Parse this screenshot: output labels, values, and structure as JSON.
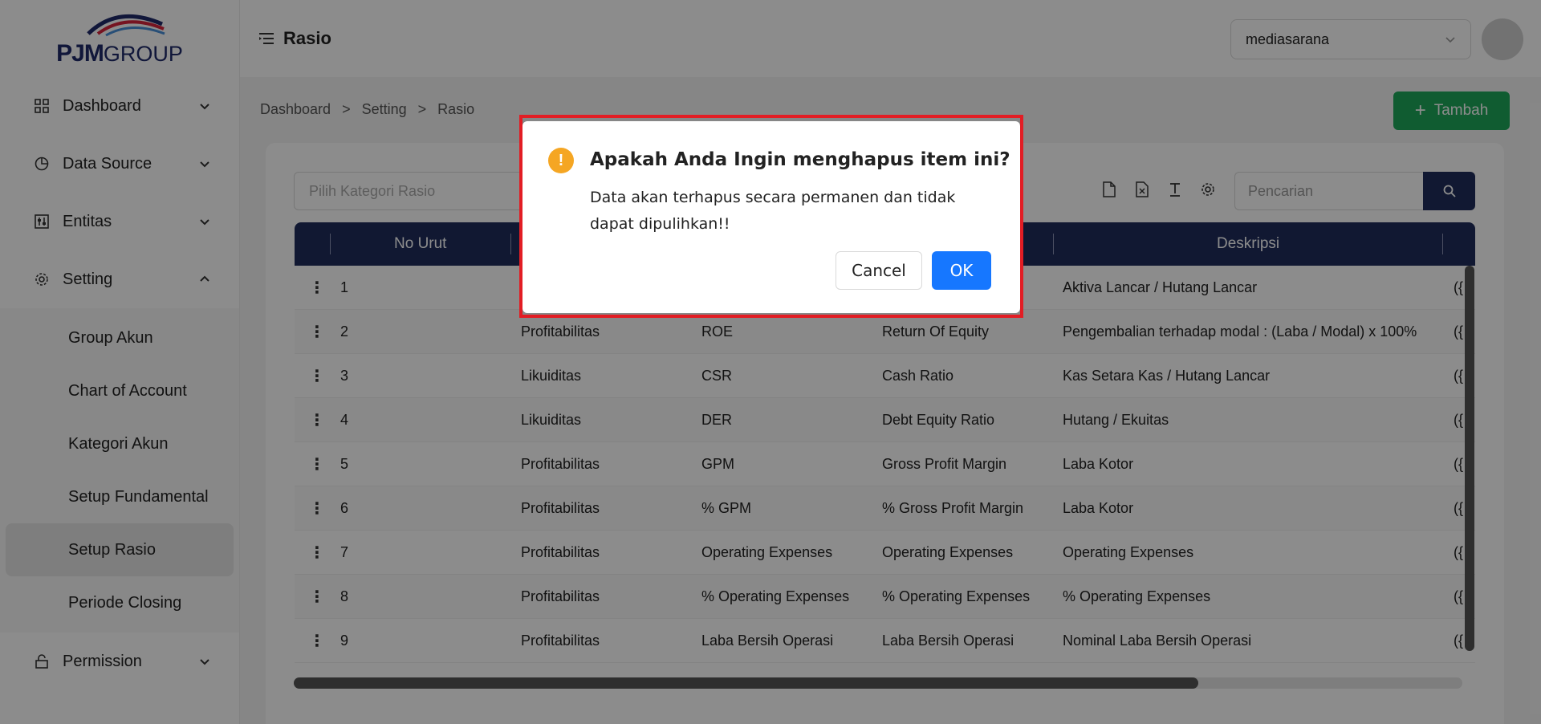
{
  "brand": {
    "logo_main": "PJM",
    "logo_sub": "GROUP"
  },
  "header": {
    "title": "Rasio",
    "company_select": "mediasarana"
  },
  "sidebar": {
    "items": [
      {
        "label": "Dashboard",
        "icon": "dashboard-icon",
        "expanded": false
      },
      {
        "label": "Data Source",
        "icon": "pie-chart-icon",
        "expanded": false
      },
      {
        "label": "Entitas",
        "icon": "sliders-icon",
        "expanded": false
      },
      {
        "label": "Setting",
        "icon": "gear-icon",
        "expanded": true
      },
      {
        "label": "Permission",
        "icon": "lock-icon",
        "expanded": false
      }
    ],
    "setting_sub": [
      {
        "label": "Group Akun"
      },
      {
        "label": "Chart of Account"
      },
      {
        "label": "Kategori Akun"
      },
      {
        "label": "Setup Fundamental"
      },
      {
        "label": "Setup Rasio",
        "active": true
      },
      {
        "label": "Periode Closing"
      }
    ]
  },
  "breadcrumb": [
    "Dashboard",
    ">",
    "Setting",
    ">",
    "Rasio"
  ],
  "actions": {
    "add_label": "Tambah"
  },
  "filter": {
    "placeholder": "Pilih Kategori Rasio"
  },
  "search": {
    "placeholder": "Pencarian"
  },
  "table": {
    "headers": {
      "no_urut": "No Urut",
      "deskripsi": "Deskripsi"
    },
    "rows": [
      {
        "no": "1",
        "kategori": "",
        "kode": "",
        "nama": "",
        "deskripsi": "Aktiva Lancar / Hutang Lancar",
        "extra": "({"
      },
      {
        "no": "2",
        "kategori": "Profitabilitas",
        "kode": "ROE",
        "nama": "Return Of Equity",
        "deskripsi": "Pengembalian terhadap modal : (Laba / Modal) x 100%",
        "extra": "({"
      },
      {
        "no": "3",
        "kategori": "Likuiditas",
        "kode": "CSR",
        "nama": "Cash Ratio",
        "deskripsi": "Kas Setara Kas / Hutang Lancar",
        "extra": "({"
      },
      {
        "no": "4",
        "kategori": "Likuiditas",
        "kode": "DER",
        "nama": "Debt Equity Ratio",
        "deskripsi": "Hutang / Ekuitas",
        "extra": "({"
      },
      {
        "no": "5",
        "kategori": "Profitabilitas",
        "kode": "GPM",
        "nama": "Gross Profit Margin",
        "deskripsi": "Laba Kotor",
        "extra": "({"
      },
      {
        "no": "6",
        "kategori": "Profitabilitas",
        "kode": "% GPM",
        "nama": "% Gross Profit Margin",
        "deskripsi": "Laba Kotor",
        "extra": "({"
      },
      {
        "no": "7",
        "kategori": "Profitabilitas",
        "kode": "Operating Expenses",
        "nama": "Operating Expenses",
        "deskripsi": "Operating Expenses",
        "extra": "({"
      },
      {
        "no": "8",
        "kategori": "Profitabilitas",
        "kode": "% Operating Expenses",
        "nama": "% Operating Expenses",
        "deskripsi": "% Operating Expenses",
        "extra": "({"
      },
      {
        "no": "9",
        "kategori": "Profitabilitas",
        "kode": "Laba Bersih Operasi",
        "nama": "Laba Bersih Operasi",
        "deskripsi": "Nominal Laba Bersih Operasi",
        "extra": "({"
      }
    ]
  },
  "dialog": {
    "title": "Apakah Anda Ingin menghapus item ini?",
    "message": "Data akan terhapus secara permanen dan tidak dapat dipulihkan!!",
    "cancel_label": "Cancel",
    "ok_label": "OK",
    "icon": "warning-icon",
    "highlight_color": "#e21d24"
  },
  "colors": {
    "primary_navy": "#1f2d5c",
    "success_green": "#1ea85a",
    "ok_blue": "#1677ff",
    "warning": "#f5a623"
  }
}
